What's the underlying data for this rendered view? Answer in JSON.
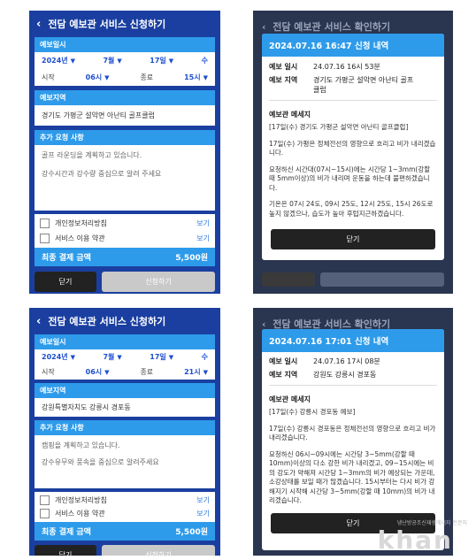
{
  "form_a": {
    "title": "전담 예보관 서비스 신청하기",
    "date_label": "예보일시",
    "year": "2024년",
    "month": "7월",
    "day": "17일",
    "weekday": "수",
    "start_label": "시작",
    "start_time": "06시",
    "end_label": "종료",
    "end_time": "15시",
    "region_label": "예보지역",
    "region": "경기도 가평군 설악면 아난티 골프클럽",
    "req_label": "추가 요청 사항",
    "req_line1": "골프 라운딩을 계획하고 있습니다.",
    "req_line2": "강수시간과 강수량 중심으로 알려 주세요",
    "privacy": "개인정보처리방침",
    "terms": "서비스 이용 약관",
    "view1": "보기",
    "view2": "보기",
    "pay_label": "최종 결제 금액",
    "pay_value": "5,500원",
    "close": "닫기",
    "apply": "신청하기"
  },
  "confirm_b": {
    "bg_title": "전담 예보관 서비스 확인하기",
    "head": "2024.07.16 16:47 신청 내역",
    "time_key": "예보 일시",
    "time_val": "24.07.16 16시 53분",
    "region_key": "예보 지역",
    "region_val": "경기도 가평군 설악면 아난티 골프클럽",
    "msg_title": "예보관 메세지",
    "msg1": "[17일(수) 경기도 가평군 설악면 아난티 골프클럽]",
    "msg2": "17일(수) 가평은 정체전선의 영향으로 흐리고 비가 내리겠습니다.",
    "msg3": "요청하신 시간대(07시~15시)에는 시간당 1~3mm(강할 때 5mm이상)의 비가 내리며 운동을 하는데 불편하겠습니다.",
    "msg4": "기온은 07시 24도, 09시 25도, 12시 25도, 15시 26도로 높지 않겠으나, 습도가 높아 후텁지근하겠습니다.",
    "close": "닫기"
  },
  "form_c": {
    "title": "전담 예보관 서비스 신청하기",
    "date_label": "예보일시",
    "year": "2024년",
    "month": "7월",
    "day": "17일",
    "weekday": "수",
    "start_label": "시작",
    "start_time": "06시",
    "end_label": "종료",
    "end_time": "21시",
    "region_label": "예보지역",
    "region": "강원특별자치도 강릉시 경포동",
    "req_label": "추가 요청 사항",
    "req_line1": "캠핑을 계획하고 있습니다.",
    "req_line2": "강수유무와 풍속을 중심으로 알려주세요",
    "privacy": "개인정보처리방침",
    "terms": "서비스 이용 약관",
    "view1": "보기",
    "view2": "보기",
    "pay_label": "최종 결제 금액",
    "pay_value": "5,500원",
    "close": "닫기",
    "apply": "신청하기"
  },
  "confirm_d": {
    "bg_title": "전담 예보관 서비스 확인하기",
    "head": "2024.07.16 17:01 신청 내역",
    "time_key": "예보 일시",
    "time_val": "24.07.16 17시 08분",
    "region_key": "예보 지역",
    "region_val": "강원도 강릉시 경포동",
    "msg_title": "예보관 메세지",
    "msg1": "[17일(수) 강릉시 경포동 예보]",
    "msg2": "17일(수) 강릉시 경포동은 정체전선의 영향으로 흐리고 비가 내리겠습니다.",
    "msg3": "요청하신 06시~09시에는 시간당 3~5mm(강할 때 10mm)이상의 다소 강한 비가 내리겠고, 09~15시에는 비의 강도가 약해져 시간당 1~3mm의 비가 예상되는 가운데, 소강상태를 보일 때가 많겠습니다. 15시부터는 다시 비가 강해지기 시작해 시간당 3~5mm(강할 때 10mm)의 비가 내리겠습니다.",
    "close": "닫기"
  },
  "watermark": {
    "logo": "khan",
    "sub": "냉난방공조신재생에너지 전문지"
  }
}
